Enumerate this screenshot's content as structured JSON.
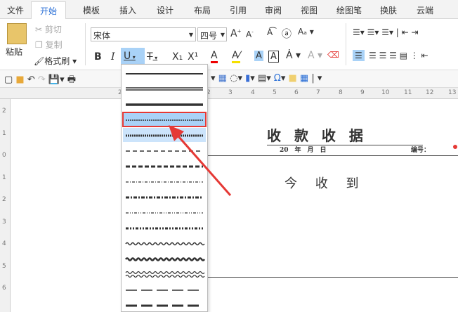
{
  "tabs": [
    "文件",
    "开始",
    "模板",
    "插入",
    "设计",
    "布局",
    "引用",
    "审阅",
    "视图",
    "绘图笔",
    "换肤",
    "云端"
  ],
  "active_tab": "开始",
  "clipboard": {
    "paste": "粘贴",
    "cut": "剪切",
    "copy": "复制",
    "format_painter": "格式刷"
  },
  "font": {
    "name": "宋体",
    "size": "四号"
  },
  "format_buttons": {
    "bold": "B",
    "italic": "I",
    "underline": "U",
    "strike": "T",
    "subscript": "X₁",
    "superscript": "X¹"
  },
  "ruler_h": [
    "2",
    "2",
    "3",
    "4",
    "5",
    "6",
    "7",
    "8",
    "9",
    "10",
    "11",
    "12",
    "13"
  ],
  "ruler_v": [
    "2",
    "1",
    "0",
    "1",
    "2",
    "3",
    "4",
    "5",
    "6"
  ],
  "underline_styles": [
    "single",
    "double",
    "thick",
    "dotted",
    "dotted-heavy",
    "dashed",
    "dashed-heavy",
    "dash-dot",
    "dash-dot-heavy",
    "dash-dot-dot",
    "dash-dot-dot-heavy",
    "wave",
    "wave-heavy",
    "wave-double",
    "dash-long",
    "dash-long-heavy"
  ],
  "selected_style": "dotted",
  "document": {
    "title": "收 款 收 据",
    "date_line": "20　年　月　日",
    "number_label": "编号：",
    "received": "今 收 到"
  },
  "colors": {
    "accent": "#2a6fd6",
    "highlight": "#a9d2f7",
    "arrow": "#e53935"
  }
}
